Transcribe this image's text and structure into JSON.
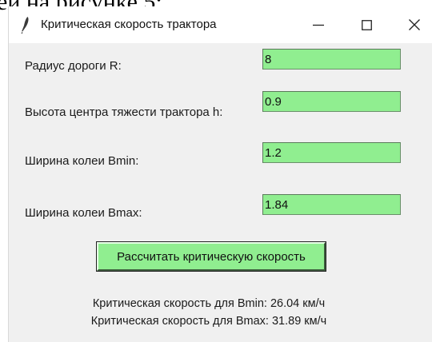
{
  "caption": "ей на рисунке 5:",
  "window": {
    "title": "Критическая скорость трактора",
    "icon": "feather-icon",
    "controls": {
      "minimize": "minimize-icon",
      "maximize": "maximize-icon",
      "close": "close-icon"
    }
  },
  "form": {
    "radius_label": "Радиус дороги R:",
    "radius_value": "8",
    "height_label": "Высота центра тяжести трактора h:",
    "height_value": "0.9",
    "bmin_label": "Ширина колеи Bmin:",
    "bmin_value": "1.2",
    "bmax_label": "Ширина колеи Bmax:",
    "bmax_value": "1.84"
  },
  "button": {
    "label": "Рассчитать критическую скорость"
  },
  "results": {
    "bmin": "Критическая скорость для Bmin: 26.04 км/ч",
    "bmax": "Критическая скорость для Bmax: 31.89 км/ч"
  },
  "colors": {
    "accent_green": "#90ee90",
    "window_bg": "#f0f0f0"
  }
}
